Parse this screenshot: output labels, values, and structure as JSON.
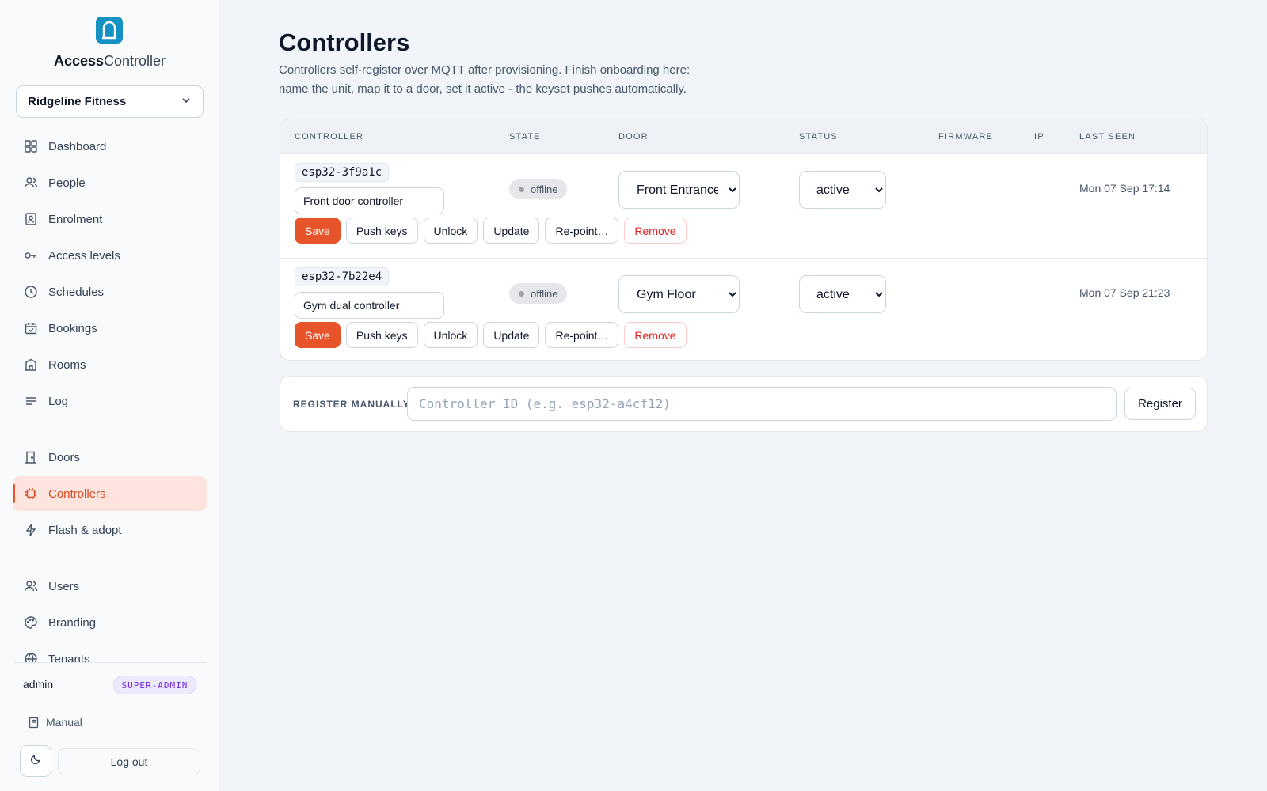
{
  "brand": {
    "part1": "Access",
    "part2": "Controller",
    "logo_icon": "door-lock-icon"
  },
  "tenant": {
    "selected": "Ridgeline Fitness"
  },
  "nav": {
    "items": [
      {
        "label": "Dashboard",
        "icon": "grid-icon"
      },
      {
        "label": "People",
        "icon": "users-icon"
      },
      {
        "label": "Enrolment",
        "icon": "badge-icon"
      },
      {
        "label": "Access levels",
        "icon": "key-icon"
      },
      {
        "label": "Schedules",
        "icon": "clock-icon"
      },
      {
        "label": "Bookings",
        "icon": "calendar-check-icon"
      },
      {
        "label": "Rooms",
        "icon": "building-icon"
      },
      {
        "label": "Log",
        "icon": "list-icon"
      },
      {
        "label": "Doors",
        "icon": "door-icon"
      },
      {
        "label": "Controllers",
        "icon": "chip-icon",
        "active": true
      },
      {
        "label": "Flash & adopt",
        "icon": "bolt-icon"
      },
      {
        "label": "Users",
        "icon": "users-icon"
      },
      {
        "label": "Branding",
        "icon": "palette-icon"
      },
      {
        "label": "Tenants",
        "icon": "globe-icon"
      }
    ]
  },
  "user": {
    "name": "admin",
    "role": "SUPER-ADMIN"
  },
  "footer": {
    "manual": "Manual",
    "logout": "Log out"
  },
  "page": {
    "title": "Controllers",
    "description": "Controllers self-register over MQTT after provisioning. Finish onboarding here: name the unit, map it to a door, set it active - the keyset pushes automatically."
  },
  "table": {
    "headers": {
      "controller": "CONTROLLER",
      "state": "STATE",
      "door": "DOOR",
      "status": "STATUS",
      "firmware": "FIRMWARE",
      "ip": "IP",
      "last_seen": "LAST SEEN"
    },
    "actions": {
      "save": "Save",
      "push": "Push keys",
      "unlock": "Unlock",
      "update": "Update",
      "repoint": "Re-point…",
      "remove": "Remove"
    },
    "rows": [
      {
        "id": "esp32-3f9a1c",
        "name": "Front door controller",
        "state": "offline",
        "door": "Front Entrance",
        "status": "active",
        "firmware": "",
        "ip": "",
        "last_seen": "Mon 07 Sep 17:14"
      },
      {
        "id": "esp32-7b22e4",
        "name": "Gym dual controller",
        "state": "offline",
        "door": "Gym Floor",
        "status": "active",
        "firmware": "",
        "ip": "",
        "last_seen": "Mon 07 Sep 21:23"
      }
    ]
  },
  "register": {
    "label": "REGISTER MANUALLY",
    "placeholder": "Controller ID (e.g. esp32-a4cf12)",
    "button": "Register"
  },
  "colors": {
    "accent": "#e8542a",
    "brand": "#1591c4",
    "active_bg": "#fde4df"
  }
}
